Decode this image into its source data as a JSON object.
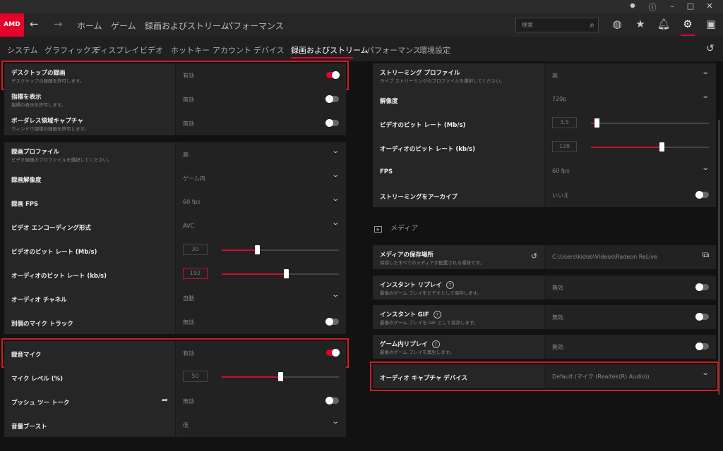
{
  "titlebar": {
    "icons": [
      "bug-icon",
      "help-icon",
      "minimize-icon",
      "maximize-icon",
      "close-icon"
    ]
  },
  "nav": {
    "logo": "AMD",
    "links": [
      "ホーム",
      "ゲーム",
      "録画およびストリーム",
      "パフォーマンス"
    ],
    "search_placeholder": "検索"
  },
  "subtabs": [
    "システム",
    "グラフィックス",
    "ディスプレイ",
    "ビデオ",
    "ホットキー",
    "アカウント",
    "デバイス",
    "録画およびストリーム",
    "パフォーマンス",
    "環境設定"
  ],
  "active_subtab": "録画およびストリーム",
  "left_groups": [
    [
      {
        "title": "デスクトップの録画",
        "desc": "デスクトップの録画を許可します。",
        "type": "toggle",
        "value": "有効",
        "on": true,
        "highlight": true
      },
      {
        "title": "指標を表示",
        "desc": "指標の表示を許可します。",
        "type": "toggle",
        "value": "無効",
        "on": false
      },
      {
        "title": "ボーダレス領域キャプチャ",
        "desc": "ウィンドウ領域の録画を許可します。",
        "type": "toggle",
        "value": "無効",
        "on": false
      }
    ],
    [
      {
        "title": "録画プロファイル",
        "desc": "ビデオ録画のプロファイルを選択してください。",
        "type": "dropdown",
        "value": "高"
      },
      {
        "title": "録画解像度",
        "type": "dropdown",
        "value": "ゲーム内"
      },
      {
        "title": "録画 FPS",
        "type": "dropdown",
        "value": "60 fps"
      },
      {
        "title": "ビデオ エンコーディング形式",
        "type": "dropdown",
        "value": "AVC"
      },
      {
        "title": "ビデオのビット レート (Mb/s)",
        "type": "slider",
        "value": "30",
        "fill": 0.3
      },
      {
        "title": "オーディオのビット レート (kb/s)",
        "type": "slider",
        "value": "192",
        "fill": 0.55,
        "focus": true
      },
      {
        "title": "オーディオ チャネル",
        "type": "dropdown",
        "value": "自動"
      },
      {
        "title": "別個のマイク トラック",
        "type": "toggle",
        "value": "無効",
        "on": false
      }
    ],
    [
      {
        "title": "録音マイク",
        "type": "toggle",
        "value": "有効",
        "on": true,
        "highlight": true
      },
      {
        "title": "マイク レベル (%)",
        "type": "slider",
        "value": "50",
        "fill": 0.5
      },
      {
        "title": "プッシュ ツー トーク",
        "type": "toggle",
        "value": "無効",
        "on": false,
        "side_icon": "share-arrow-icon"
      },
      {
        "title": "音量ブースト",
        "type": "dropdown",
        "value": "低"
      }
    ]
  ],
  "right_groups": [
    [
      {
        "title": "ストリーミング プロファイル",
        "desc": "ライブ ストリーミングのプロファイルを選択してください。",
        "type": "dropdown",
        "value": "高"
      },
      {
        "title": "解像度",
        "type": "dropdown",
        "value": "720p"
      },
      {
        "title": "ビデオのビット レート (Mb/s)",
        "type": "slider",
        "value": "3.5",
        "fill": 0.05
      },
      {
        "title": "オーディオのビット レート (kb/s)",
        "type": "slider",
        "value": "128",
        "fill": 0.6
      },
      {
        "title": "FPS",
        "type": "dropdown",
        "value": "60 fps"
      },
      {
        "title": "ストリーミングをアーカイブ",
        "type": "toggle",
        "value": "いいえ",
        "on": false
      }
    ]
  ],
  "media_header": "メディア",
  "media_rows": [
    {
      "title": "メディアの保存場所",
      "desc": "保存したすべてのメディアが配置される場所です。",
      "type": "path",
      "value": "C:\\Users\\kidob\\Videos\\Radeon ReLive",
      "side_icon": "reset-icon"
    },
    {
      "title": "インスタント リプレイ",
      "desc": "最後のゲーム プレイをビデオとして保存します。",
      "type": "toggle",
      "value": "無効",
      "on": false,
      "help": "?"
    },
    {
      "title": "インスタント GIF",
      "desc": "最後のゲーム プレイを GIF として保存します。",
      "type": "toggle",
      "value": "無効",
      "on": false,
      "help": "?"
    },
    {
      "title": "ゲーム内リプレイ",
      "desc": "最後のゲーム プレイを再生します。",
      "type": "toggle",
      "value": "無効",
      "on": false,
      "help": "?"
    },
    {
      "title": "オーディオ キャプチャ デバイス",
      "type": "dropdown",
      "value": "Default (マイク (Realtek(R) Audio))",
      "highlight": true
    }
  ],
  "colors": {
    "accent": "#e4002b",
    "highlight_box": "#d01c24"
  }
}
